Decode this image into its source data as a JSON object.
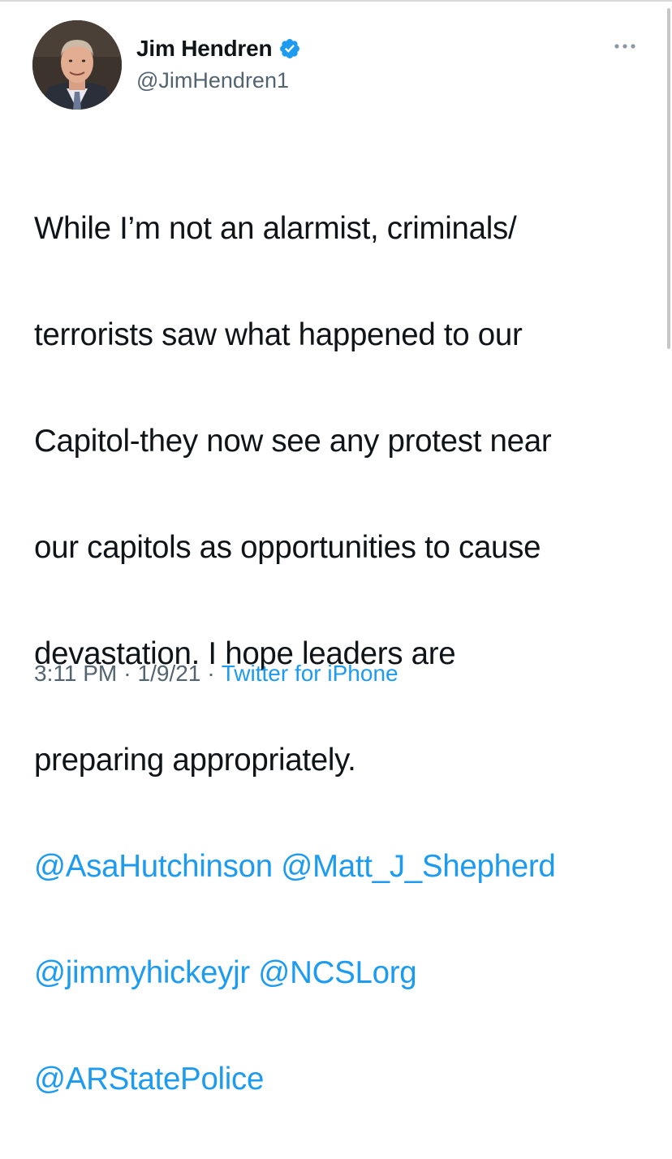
{
  "author": {
    "display_name": "Jim Hendren",
    "handle": "@JimHendren1",
    "verified": true
  },
  "tweet": {
    "text_lines": [
      "While I’m not an alarmist, criminals/",
      "terrorists saw what happened to our",
      "Capitol-they now see any protest near",
      "our capitols as opportunities to cause",
      "devastation. I hope leaders are",
      "preparing appropriately."
    ],
    "mentions": [
      {
        "text": "@AsaHutchinson"
      },
      {
        "text": "@Matt_J_Shepherd"
      },
      {
        "text": "@jimmyhickeyjr"
      },
      {
        "text": "@NCSLorg"
      },
      {
        "text": "@ARStatePolice"
      }
    ]
  },
  "meta": {
    "time": "3:11 PM",
    "separator": "·",
    "date": "1/9/21",
    "source": "Twitter for iPhone"
  },
  "icons": {
    "verified": "verified-badge-icon",
    "more": "more-options-icon"
  },
  "colors": {
    "text": "#0f1419",
    "secondary": "#536471",
    "link": "#1d9bf0"
  }
}
